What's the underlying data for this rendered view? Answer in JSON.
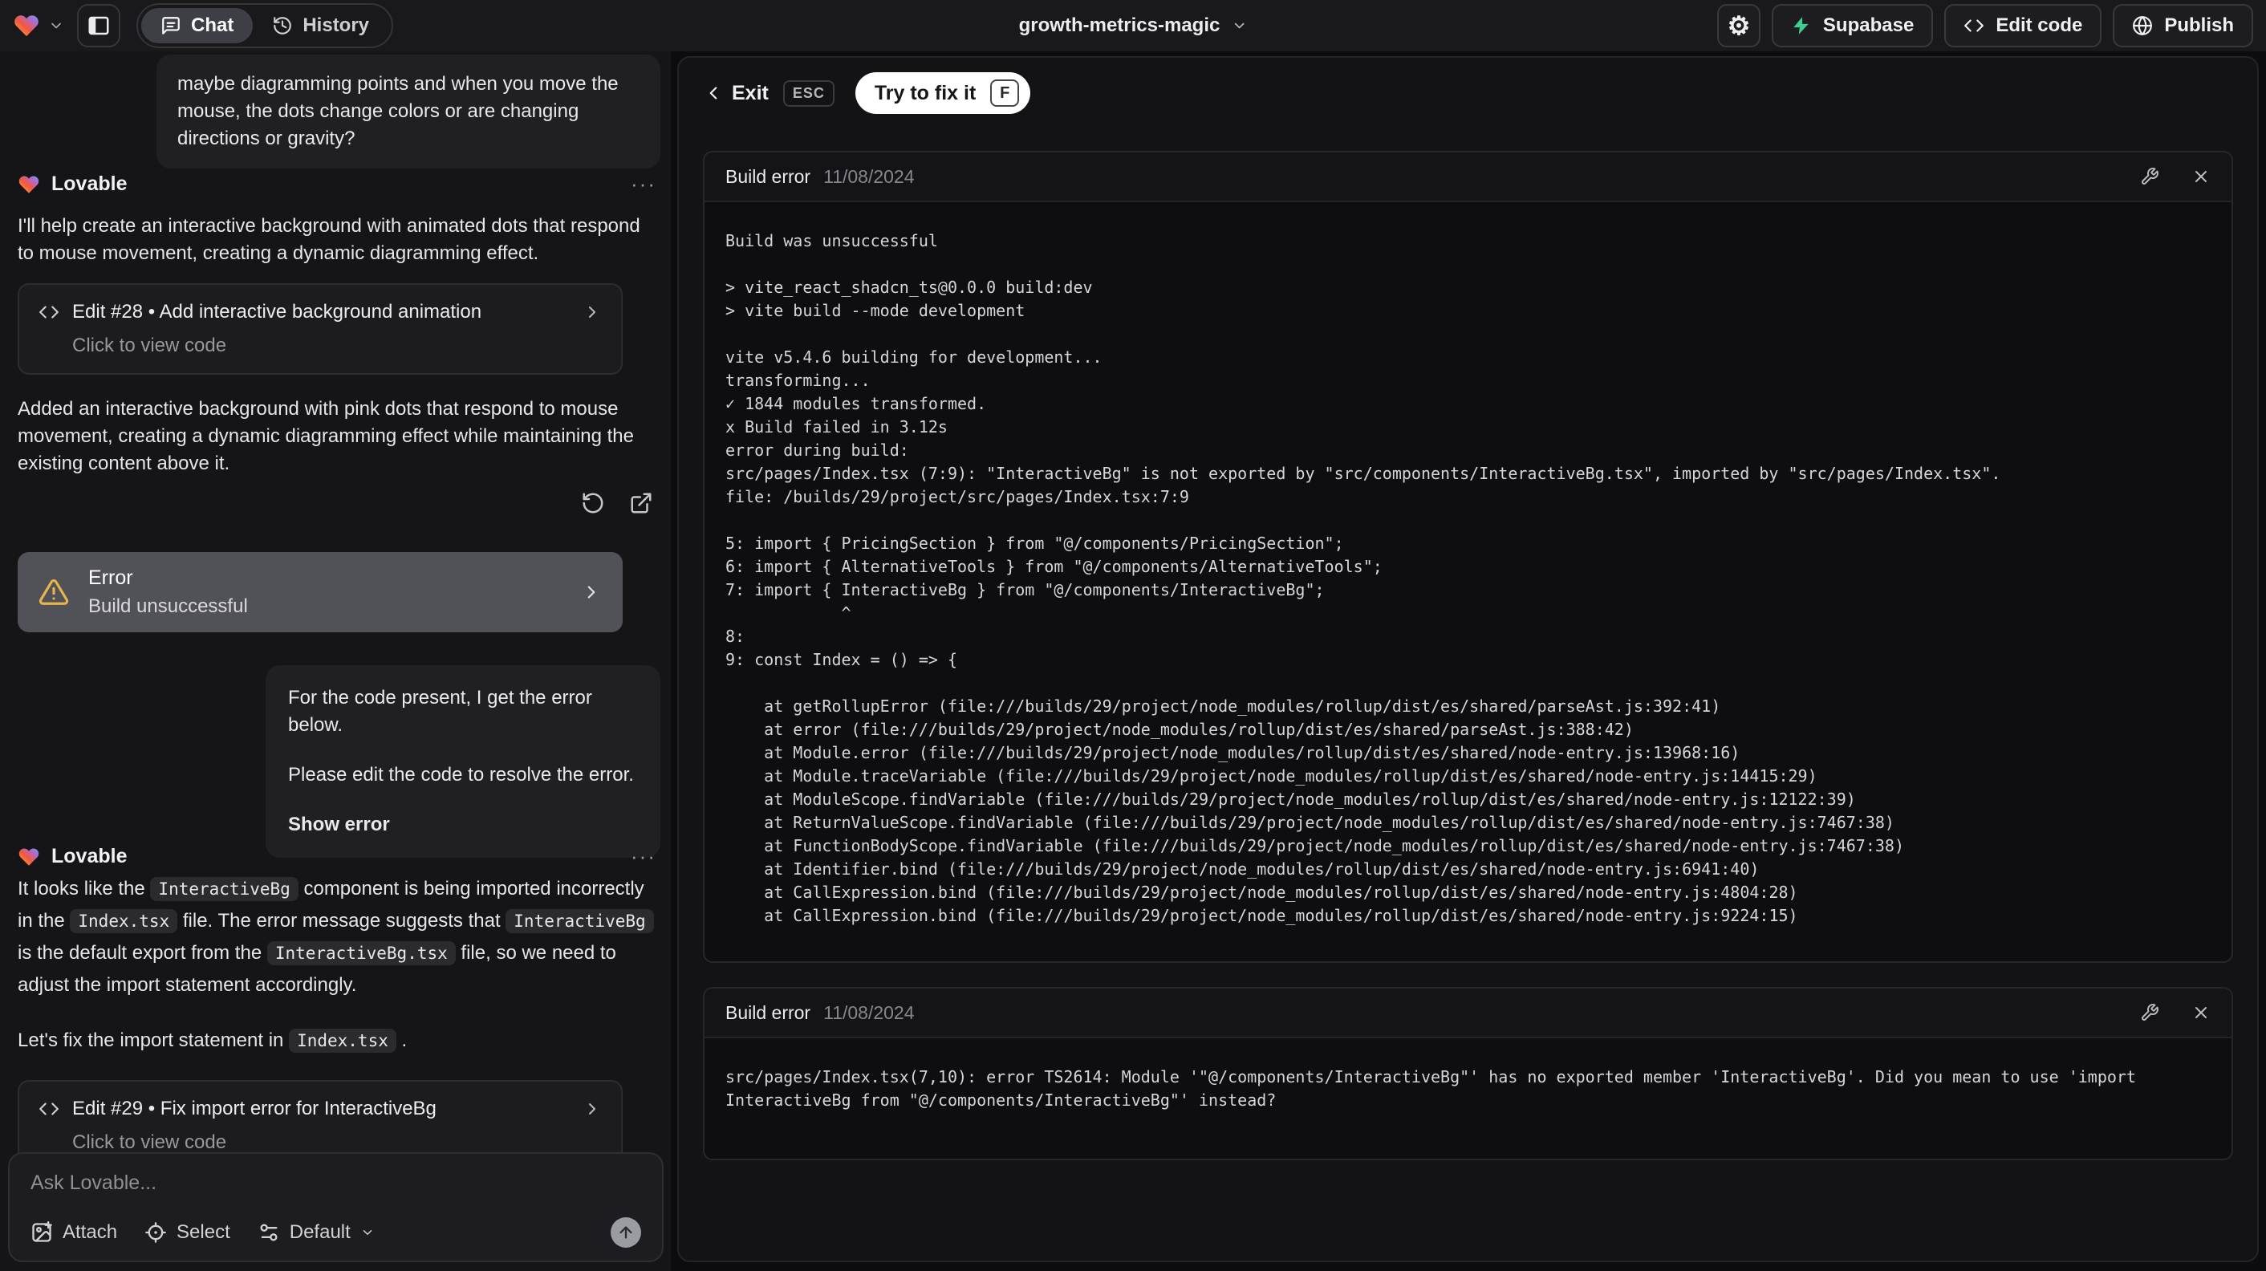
{
  "topbar": {
    "tab_chat": "Chat",
    "tab_history": "History",
    "project_name": "growth-metrics-magic",
    "gear_glyph": "⚙",
    "btn_supabase": "Supabase",
    "btn_edit_code": "Edit code",
    "btn_publish": "Publish"
  },
  "chat": {
    "agent_name": "Lovable",
    "more_glyph": "···",
    "user_msg_1": "maybe diagramming points and when you move the mouse, the dots change colors or are changing directions or gravity?",
    "agent_msg_1": {
      "intro": "I'll help create an interactive background with animated dots that respond to mouse movement, creating a dynamic diagramming effect.",
      "edit_title": "Edit #28 • Add interactive background animation",
      "edit_subtitle": "Click to view code",
      "result": "Added an interactive background with pink dots that respond to mouse movement, creating a dynamic diagramming effect while maintaining the existing content above it."
    },
    "error_pill": {
      "title": "Error",
      "subtitle": "Build unsuccessful"
    },
    "user_msg_2": {
      "p1": "For the code present, I get the error below.",
      "p2": "Please edit the code to resolve the error.",
      "action": "Show error"
    },
    "agent_msg_2": {
      "p1_t1": "It looks like the ",
      "p1_c1": "InteractiveBg",
      "p1_t2": " component is being imported incorrectly in the ",
      "p1_c2": "Index.tsx",
      "p1_t3": " file. The error message suggests that ",
      "p1_c3": "InteractiveBg",
      "p1_t4": " is the default export from the ",
      "p1_c4": "InteractiveBg.tsx",
      "p1_t5": " file, so we need to adjust the import statement accordingly.",
      "p2_t1": "Let's fix the import statement in ",
      "p2_c1": "Index.tsx",
      "p2_t2": " .",
      "edit_title": "Edit #29 • Fix import error for InteractiveBg",
      "edit_subtitle": "Click to view code"
    },
    "composer": {
      "placeholder": "Ask Lovable...",
      "attach": "Attach",
      "select": "Select",
      "mode": "Default"
    }
  },
  "preview": {
    "exit": "Exit",
    "esc_key": "ESC",
    "fix_label": "Try to fix it",
    "fix_key": "F",
    "card1": {
      "title": "Build error",
      "date": "11/08/2024",
      "log": "Build was unsuccessful\n\n> vite_react_shadcn_ts@0.0.0 build:dev\n> vite build --mode development\n\nvite v5.4.6 building for development...\ntransforming...\n✓ 1844 modules transformed.\nx Build failed in 3.12s\nerror during build:\nsrc/pages/Index.tsx (7:9): \"InteractiveBg\" is not exported by \"src/components/InteractiveBg.tsx\", imported by \"src/pages/Index.tsx\".\nfile: /builds/29/project/src/pages/Index.tsx:7:9\n\n5: import { PricingSection } from \"@/components/PricingSection\";\n6: import { AlternativeTools } from \"@/components/AlternativeTools\";\n7: import { InteractiveBg } from \"@/components/InteractiveBg\";\n            ^\n8: \n9: const Index = () => {\n\n    at getRollupError (file:///builds/29/project/node_modules/rollup/dist/es/shared/parseAst.js:392:41)\n    at error (file:///builds/29/project/node_modules/rollup/dist/es/shared/parseAst.js:388:42)\n    at Module.error (file:///builds/29/project/node_modules/rollup/dist/es/shared/node-entry.js:13968:16)\n    at Module.traceVariable (file:///builds/29/project/node_modules/rollup/dist/es/shared/node-entry.js:14415:29)\n    at ModuleScope.findVariable (file:///builds/29/project/node_modules/rollup/dist/es/shared/node-entry.js:12122:39)\n    at ReturnValueScope.findVariable (file:///builds/29/project/node_modules/rollup/dist/es/shared/node-entry.js:7467:38)\n    at FunctionBodyScope.findVariable (file:///builds/29/project/node_modules/rollup/dist/es/shared/node-entry.js:7467:38)\n    at Identifier.bind (file:///builds/29/project/node_modules/rollup/dist/es/shared/node-entry.js:6941:40)\n    at CallExpression.bind (file:///builds/29/project/node_modules/rollup/dist/es/shared/node-entry.js:4804:28)\n    at CallExpression.bind (file:///builds/29/project/node_modules/rollup/dist/es/shared/node-entry.js:9224:15)"
    },
    "card2": {
      "title": "Build error",
      "date": "11/08/2024",
      "log": "src/pages/Index.tsx(7,10): error TS2614: Module '\"@/components/InteractiveBg\"' has no exported member 'InteractiveBg'. Did you mean to use 'import InteractiveBg from \"@/components/InteractiveBg\"' instead?"
    }
  },
  "colors": {
    "supabase_green": "#3ecf8e",
    "warning_amber": "#e7b549"
  }
}
